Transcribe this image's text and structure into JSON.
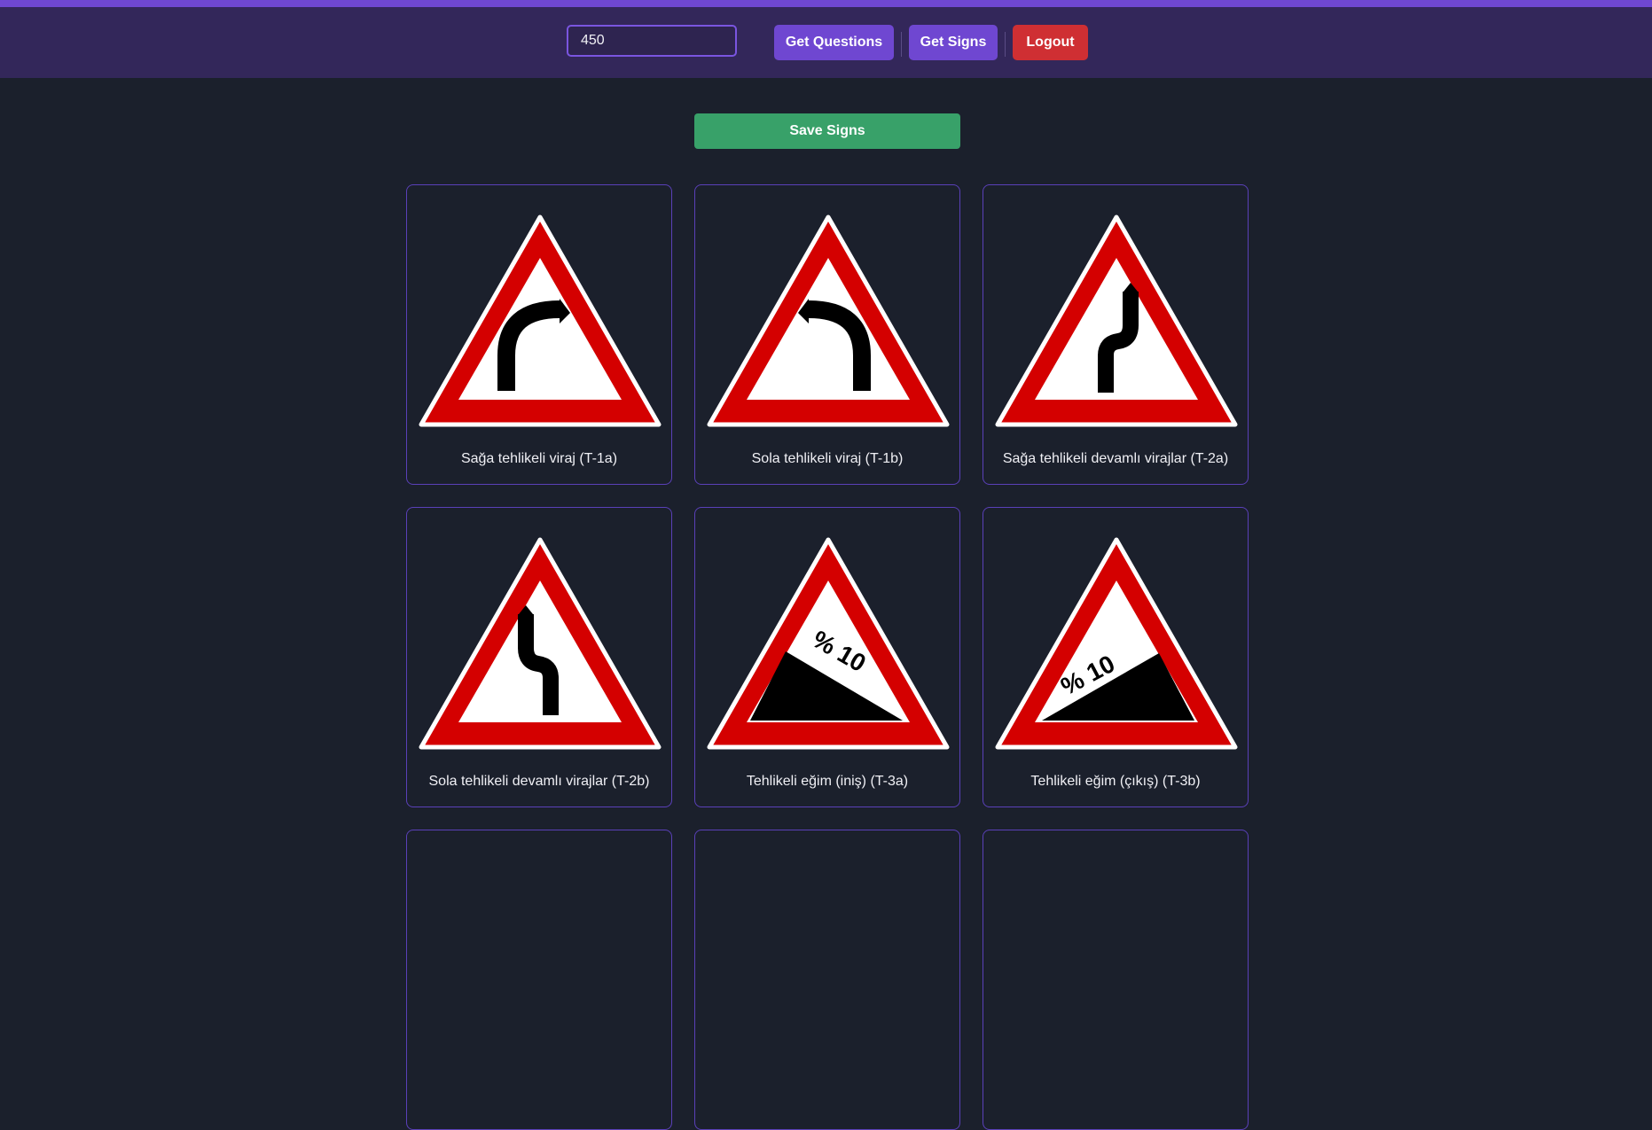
{
  "header": {
    "search_value": "450",
    "get_questions_label": "Get Questions",
    "get_signs_label": "Get Signs",
    "logout_label": "Logout"
  },
  "main": {
    "save_label": "Save Signs"
  },
  "signs": [
    {
      "label": "Sağa tehlikeli viraj (T-1a)",
      "icon": "curve-right-icon"
    },
    {
      "label": "Sola tehlikeli viraj (T-1b)",
      "icon": "curve-left-icon"
    },
    {
      "label": "Sağa tehlikeli devamlı virajlar (T-2a)",
      "icon": "double-curve-right-icon"
    },
    {
      "label": "Sola tehlikeli devamlı virajlar (T-2b)",
      "icon": "double-curve-left-icon"
    },
    {
      "label": "Tehlikeli eğim (iniş) (T-3a)",
      "icon": "steep-descent-icon",
      "text": "% 10"
    },
    {
      "label": "Tehlikeli eğim (çıkış) (T-3b)",
      "icon": "steep-ascent-icon",
      "text": "% 10"
    }
  ],
  "colors": {
    "accent": "#6f47d1",
    "danger": "#cf2f33",
    "success": "#38a169",
    "sign_red": "#d40000"
  }
}
